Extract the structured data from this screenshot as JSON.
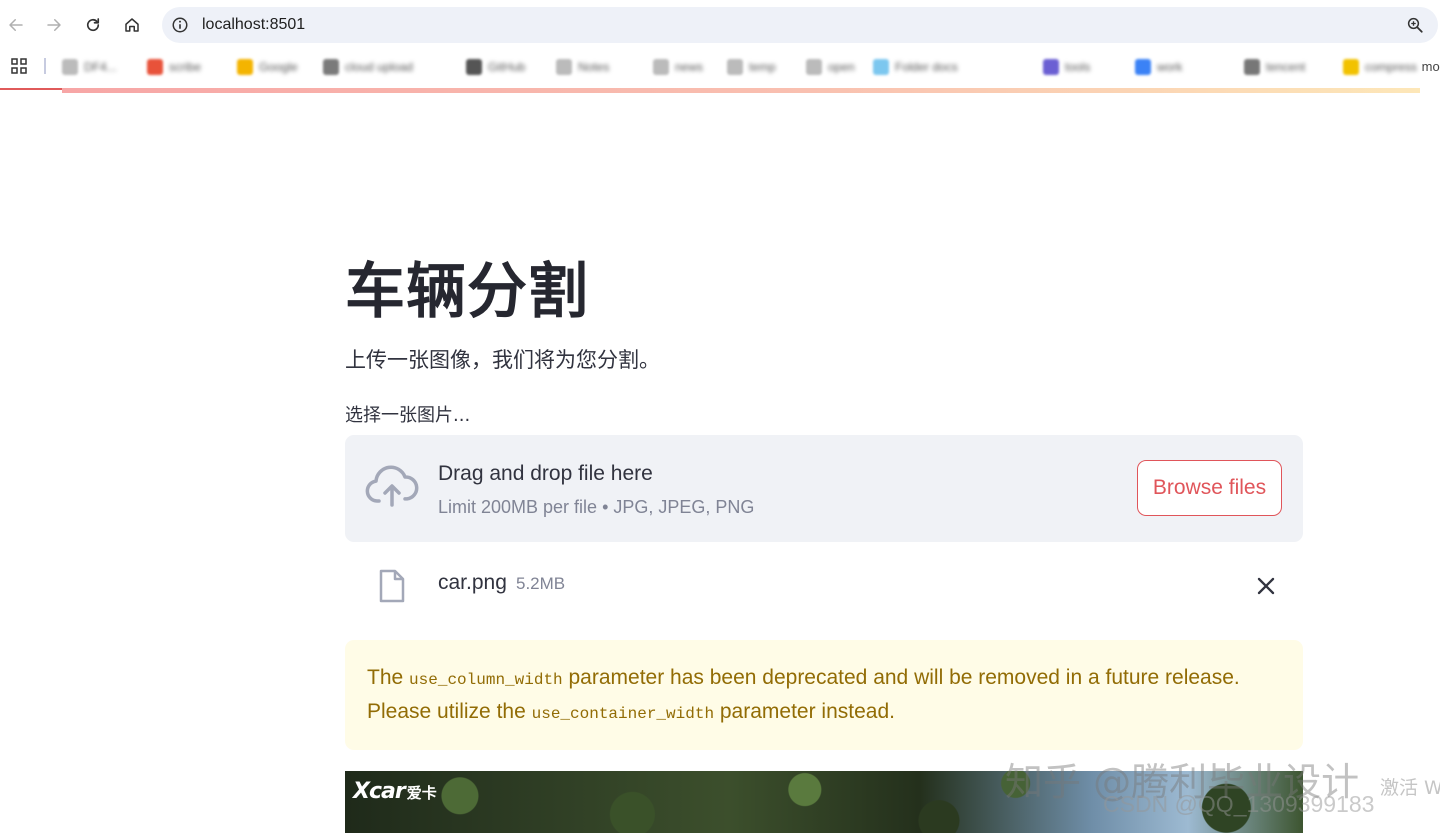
{
  "browser": {
    "url": "localhost:8501",
    "bookmarks_more": "mor",
    "bookmarks": [
      {
        "label": "DF4...",
        "color": "#bbbbbb"
      },
      {
        "label": "scribe",
        "color": "#e8523a"
      },
      {
        "label": "Google",
        "color": "#f4b400"
      },
      {
        "label": "cloud upload",
        "color": "#7a7a7a"
      },
      {
        "label": "GitHub",
        "color": "#555555"
      },
      {
        "label": "Notes",
        "color": "#bbbbbb"
      },
      {
        "label": "news",
        "color": "#bbbbbb"
      },
      {
        "label": "temp",
        "color": "#bbbbbb"
      },
      {
        "label": "open",
        "color": "#bbbbbb"
      },
      {
        "label": "Folder docs",
        "color": "#7cc7ef"
      },
      {
        "label": "tools",
        "color": "#6b5fd3"
      },
      {
        "label": "work",
        "color": "#3b82f6"
      },
      {
        "label": "tencent",
        "color": "#777777"
      },
      {
        "label": "compress",
        "color": "#f2c200"
      }
    ]
  },
  "app": {
    "title": "车辆分割",
    "subtitle": "上传一张图像，我们将为您分割。",
    "uploader_label": "选择一张图片...",
    "dropzone_title": "Drag and drop file here",
    "dropzone_limit": "Limit 200MB per file • JPG, JPEG, PNG",
    "browse_button": "Browse files",
    "file": {
      "name": "car.png",
      "size": "5.2MB"
    },
    "warning": {
      "part1": "The ",
      "code1": "use_column_width",
      "part2": " parameter has been deprecated and will be removed in a future release. Please utilize the ",
      "code2": "use_container_width",
      "part3": " parameter instead."
    },
    "image_logo": "Xcar",
    "image_logo_cn": "爱卡"
  },
  "overlays": {
    "watermark_zhihu": "知乎 @腾利毕业设计",
    "watermark_csdn": "CSDN @QQ_1309399183",
    "activate_windows": "激活 W"
  },
  "colors": {
    "primary": "#e0555a",
    "warning_bg": "#fffce7",
    "warning_text": "#926c05",
    "dropzone_bg": "#f0f2f6"
  }
}
